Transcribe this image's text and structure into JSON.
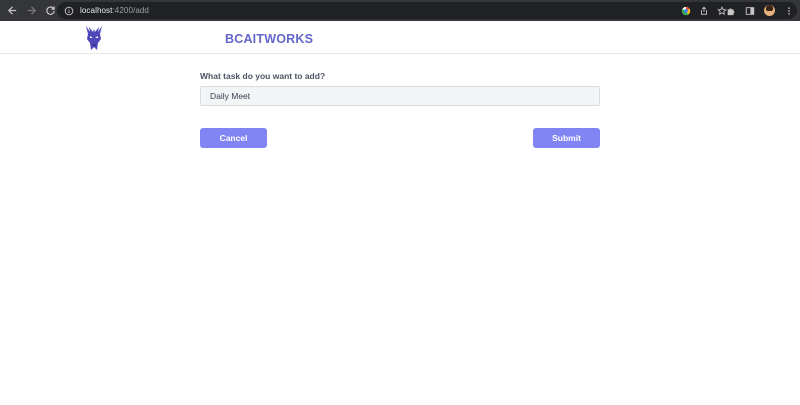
{
  "browser": {
    "url_host": "localhost",
    "url_rest": ":4200/add"
  },
  "header": {
    "brand": "BCAITWORKS",
    "brand_color": "#6466c9"
  },
  "form": {
    "label": "What task do you want to add?",
    "input_value": "Daily Meet",
    "cancel_label": "Cancel",
    "submit_label": "Submit",
    "button_color": "#8185f3"
  },
  "icons": {
    "back": "arrow-left-icon",
    "forward": "arrow-right-icon",
    "reload": "reload-icon",
    "info": "info-icon",
    "google": "google-icon",
    "share": "share-icon",
    "bookmark": "star-icon",
    "extensions": "puzzle-icon",
    "sidepanel": "side-panel-icon",
    "profile": "avatar",
    "menu": "kebab-menu-icon",
    "logo": "dragon-logo-icon"
  }
}
